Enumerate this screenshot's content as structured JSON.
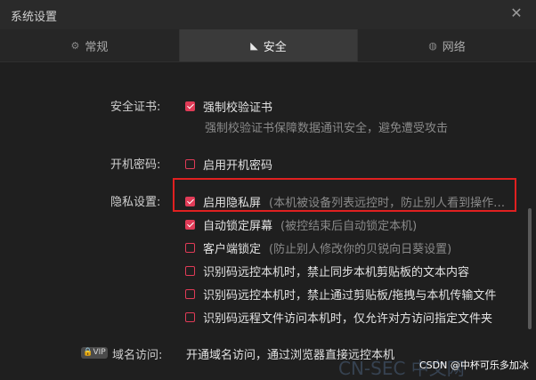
{
  "window": {
    "title": "系统设置",
    "close_glyph": "✕"
  },
  "tabs": [
    {
      "label": "常规",
      "icon": "gear-icon",
      "glyph": "⚙"
    },
    {
      "label": "安全",
      "icon": "shield-icon",
      "glyph": "◣"
    },
    {
      "label": "网络",
      "icon": "globe-icon",
      "glyph": "◍"
    }
  ],
  "cert": {
    "label": "安全证书:",
    "option": "强制校验证书",
    "description": "强制校验证书保障数据通讯安全，避免遭受攻击"
  },
  "boot_password": {
    "label": "开机密码:",
    "option": "启用开机密码"
  },
  "privacy": {
    "label": "隐私设置:",
    "items": [
      {
        "text": "启用隐私屏",
        "hint": "(本机被设备列表远控时，防止别人看到操作…",
        "checked": true
      },
      {
        "text": "自动锁定屏幕",
        "hint": "(被控结束后自动锁定本机)",
        "checked": true
      },
      {
        "text": "客户端锁定",
        "hint": "(防止别人修改你的贝锐向日葵设置)",
        "checked": false
      },
      {
        "text": "识别码远控本机时，禁止同步本机剪贴板的文本内容",
        "hint": "",
        "checked": false
      },
      {
        "text": "识别码远控本机时，禁止通过剪贴板/拖拽与本机传输文件",
        "hint": "",
        "checked": false
      },
      {
        "text": "识别码远程文件访问本机时，仅允许对方访问指定文件夹",
        "hint": "",
        "checked": false
      }
    ]
  },
  "domain": {
    "badge": "VIP",
    "label": "域名访问:",
    "text": "开通域名访问，通过浏览器直接远控本机"
  },
  "watermark": {
    "main": "CSDN @中杯可乐多加冰",
    "faded": "CN-SEC 中文网"
  },
  "colors": {
    "accent": "#e03b57",
    "highlight_box": "#e02020"
  }
}
